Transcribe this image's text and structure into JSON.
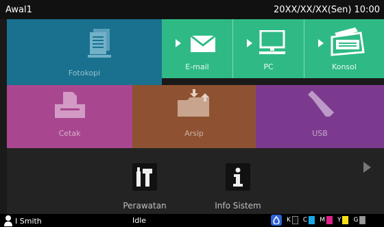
{
  "header": {
    "title": "Awal1",
    "datetime": "20XX/XX/XX(Sen) 10:00"
  },
  "tiles": {
    "fotokopi": "Fotokopi",
    "email": "E-mail",
    "pc": "PC",
    "konsol": "Konsol",
    "cetak": "Cetak",
    "arsip": "Arsip",
    "usb": "USB"
  },
  "tools": {
    "perawatan": "Perawatan",
    "info_sistem": "Info Sistem"
  },
  "status": {
    "user": "I Smith",
    "state": "Idle",
    "inks": [
      {
        "label": "K",
        "color": "#111111"
      },
      {
        "label": "C",
        "color": "#18a8e8"
      },
      {
        "label": "M",
        "color": "#e0218a"
      },
      {
        "label": "Y",
        "color": "#f5e11a"
      },
      {
        "label": "G",
        "color": "#9a9a9a"
      }
    ]
  },
  "colors": {
    "fotokopi": "#19718f",
    "send": "#2fba85",
    "cetak": "#a8478f",
    "arsip": "#8e5232",
    "usb": "#7c3a8e"
  },
  "icons": {
    "fotokopi": "document-stack-icon",
    "email": "envelope-icon",
    "pc": "monitor-icon",
    "konsol": "scanner-icon",
    "cetak": "printer-icon",
    "arsip": "folder-transfer-icon",
    "usb": "usb-stick-icon",
    "perawatan": "tools-icon",
    "info_sistem": "info-icon",
    "user": "user-icon",
    "ink": "ink-icon"
  }
}
